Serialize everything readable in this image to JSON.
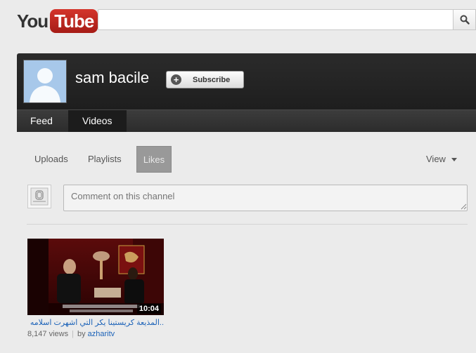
{
  "masthead": {
    "logo_you": "You",
    "logo_tube": "Tube",
    "search_placeholder": "",
    "search_icon": "search-icon"
  },
  "channel": {
    "name": "sam bacile",
    "subscribe_label": "Subscribe",
    "tabs": [
      {
        "label": "Feed",
        "active": false
      },
      {
        "label": "Videos",
        "active": true
      }
    ]
  },
  "subnav": {
    "items": [
      {
        "label": "Uploads",
        "active": false
      },
      {
        "label": "Playlists",
        "active": false
      },
      {
        "label": "Likes",
        "active": true
      }
    ],
    "view_label": "View"
  },
  "comment": {
    "placeholder": "Comment on this channel"
  },
  "videos": [
    {
      "title": "..المذيعة كريستينا يكر التي اشهرت اسلامه",
      "duration": "10:04",
      "views": "8,147 views",
      "by_label": "by",
      "author": "azharitv"
    }
  ],
  "colors": {
    "header_bg": "#222222",
    "tab_active_bg": "#1c1c1c",
    "link": "#1b62b8",
    "logo_red": "#c4302b"
  }
}
